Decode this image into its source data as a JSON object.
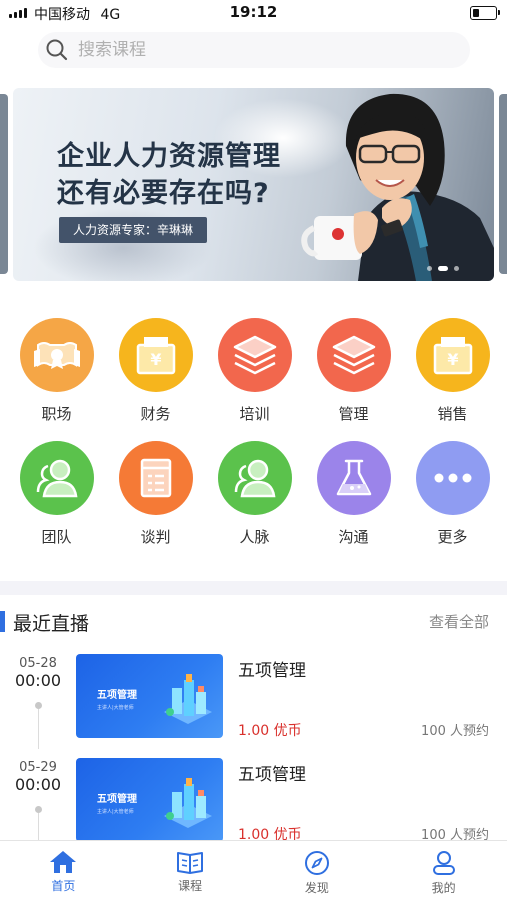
{
  "status_bar": {
    "carrier": "中国移动",
    "network": "4G",
    "time": "19:12",
    "battery_level": 0.3
  },
  "search": {
    "placeholder": "搜索课程",
    "icon": "search-icon"
  },
  "banner": {
    "headline_line1": "企业人力资源管理",
    "headline_line2": "还有必要存在吗?",
    "expert": "人力资源专家：辛琳琳",
    "active_slide": 2,
    "slide_count": 3
  },
  "categories": [
    {
      "label": "职场",
      "icon": "certificate-icon",
      "color": "#f5a646"
    },
    {
      "label": "财务",
      "icon": "finance-box-icon",
      "color": "#f6b51d"
    },
    {
      "label": "培训",
      "icon": "layers-icon",
      "color": "#f2674d"
    },
    {
      "label": "管理",
      "icon": "layers-icon",
      "color": "#f2674d"
    },
    {
      "label": "销售",
      "icon": "sales-box-icon",
      "color": "#f6b51d"
    },
    {
      "label": "团队",
      "icon": "people-icon",
      "color": "#5bc24c"
    },
    {
      "label": "谈判",
      "icon": "document-icon",
      "color": "#f57a36"
    },
    {
      "label": "人脉",
      "icon": "people-icon",
      "color": "#5bc24c"
    },
    {
      "label": "沟通",
      "icon": "flask-icon",
      "color": "#9b84ea"
    },
    {
      "label": "更多",
      "icon": "more-icon",
      "color": "#8f9cf2"
    }
  ],
  "live_section": {
    "title": "最近直播",
    "view_all": "查看全部",
    "items": [
      {
        "date": "05-28",
        "time": "00:00",
        "thumb_title": "五项管理",
        "thumb_sub": "主讲人|大管老师",
        "title": "五项管理",
        "price": "1.00 优币",
        "booked": "100 人预约"
      },
      {
        "date": "05-29",
        "time": "00:00",
        "thumb_title": "五项管理",
        "thumb_sub": "主讲人|大管老师",
        "title": "五项管理",
        "price": "1.00 优币",
        "booked": "100 人预约"
      }
    ]
  },
  "tabbar": {
    "active": 0,
    "tabs": [
      {
        "label": "首页",
        "icon": "home-icon"
      },
      {
        "label": "课程",
        "icon": "book-icon"
      },
      {
        "label": "发现",
        "icon": "compass-icon"
      },
      {
        "label": "我的",
        "icon": "user-icon"
      }
    ]
  },
  "colors": {
    "accent": "#2f6fe0",
    "price": "#d9302c"
  }
}
